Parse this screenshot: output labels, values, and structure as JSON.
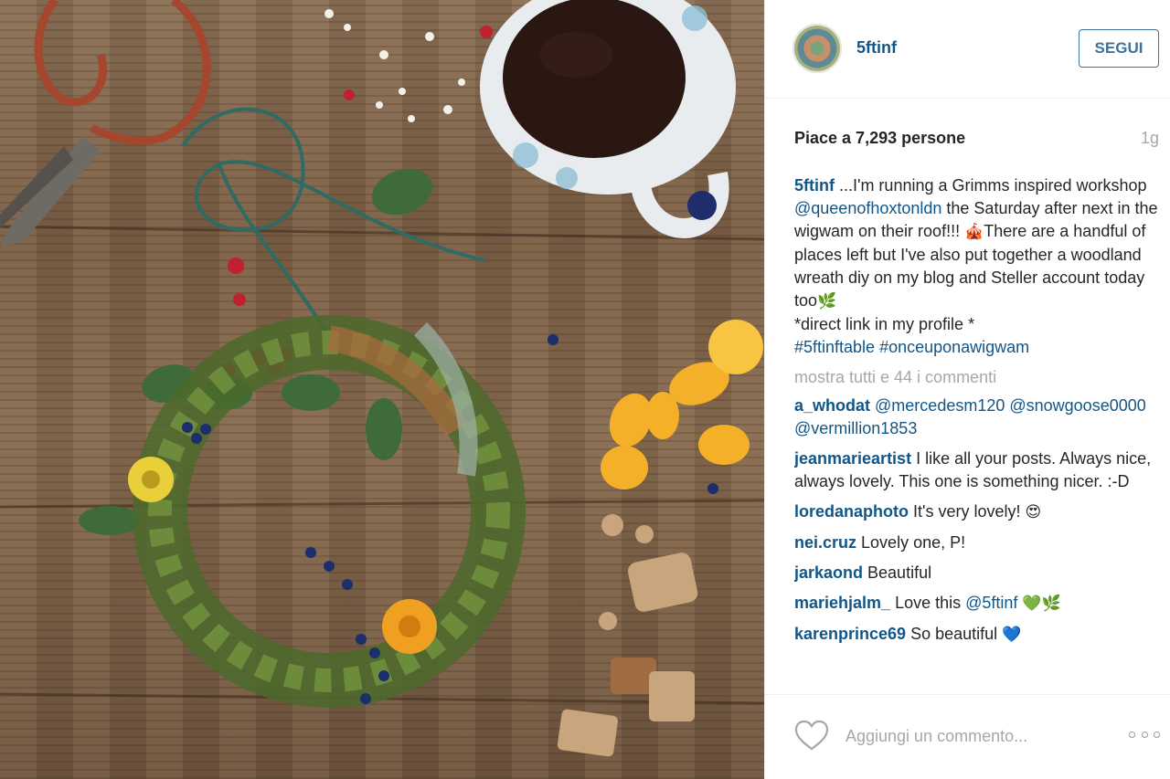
{
  "post": {
    "photo_alt": "wreath on wooden table",
    "author": "5ftinf",
    "follow_label": "SEGUI",
    "likes_text": "Piace a 7,293 persone",
    "time_ago": "1g",
    "caption": {
      "user": "5ftinf",
      "text_1": " ...I'm running a Grimms inspired workshop ",
      "mention": "@queenofhoxtonldn",
      "text_2": " the Saturday after next in the wigwam on their roof!!! ",
      "emoji_1": "🎪",
      "text_3": "There are a handful of places left but I've also put together a woodland wreath diy on my blog and Steller account today too",
      "emoji_2": "🌿",
      "text_4": "*direct link in my profile *",
      "hashtags": "#5ftinftable #onceuponawigwam"
    },
    "show_all_comments": "mostra tutti e 44 i commenti",
    "comments": [
      {
        "user": "a_whodat",
        "text": "",
        "mention": "@mercedesm120 @snowgoose0000 @vermillion1853",
        "emoji": ""
      },
      {
        "user": "jeanmarieartist",
        "text": " I like all your posts. Always nice, always lovely. This one is something nicer. :-D",
        "mention": "",
        "emoji": ""
      },
      {
        "user": "loredanaphoto",
        "text": " It's very lovely! ",
        "mention": "",
        "emoji": "😍"
      },
      {
        "user": "nei.cruz",
        "text": " Lovely one, P!",
        "mention": "",
        "emoji": ""
      },
      {
        "user": "jarkaond",
        "text": " Beautiful",
        "mention": "",
        "emoji": ""
      },
      {
        "user": "mariehjalm_",
        "text": " Love this ",
        "mention": "@5ftinf",
        "emoji": "💚🌿"
      },
      {
        "user": "karenprince69",
        "text": " So beautiful ",
        "mention": "",
        "emoji": "💙"
      }
    ],
    "comment_placeholder": "Aggiungi un commento...",
    "icons": {
      "like": "heart-icon",
      "options": "more-options-icon"
    }
  }
}
